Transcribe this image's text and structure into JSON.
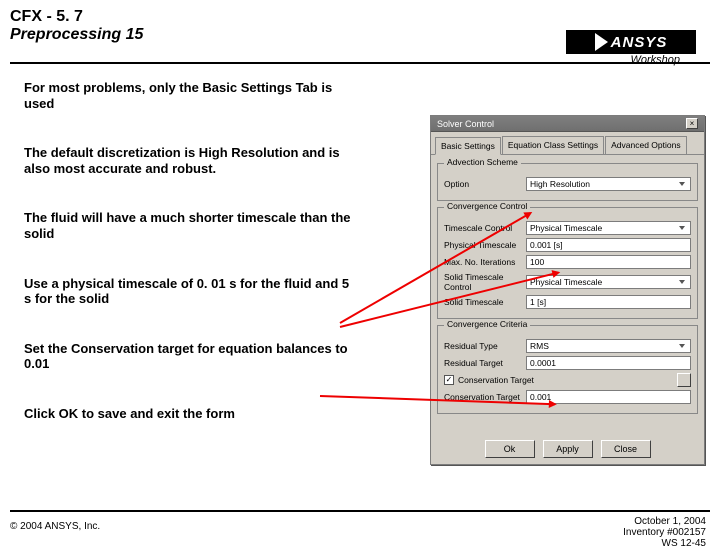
{
  "header": {
    "line1": "CFX - 5. 7",
    "line2": "Preprocessing 15",
    "logo_text": "ANSYS",
    "workshop": "Workshop"
  },
  "bullets": {
    "b1": "For most problems, only the Basic Settings Tab is used",
    "b2": "The default discretization is High Resolution and is also most accurate and robust.",
    "b3": "The fluid will have a much shorter timescale than the solid",
    "b4": "Use a physical timescale of 0. 01 s for the fluid and 5 s for the solid",
    "b5": "Set the Conservation target for equation balances to 0.01",
    "b6": "Click OK to save and exit the form"
  },
  "dialog": {
    "title": "Solver Control",
    "tabs": {
      "t1": "Basic Settings",
      "t2": "Equation Class Settings",
      "t3": "Advanced Options"
    },
    "adv_group": "Advection Scheme",
    "adv_option_lbl": "Option",
    "adv_option_val": "High Resolution",
    "conv_group": "Convergence Control",
    "tc_lbl": "Timescale Control",
    "tc_val": "Physical Timescale",
    "pt_lbl": "Physical Timescale",
    "pt_val": "0.001 [s]",
    "mi_lbl": "Max. No. Iterations",
    "mi_val": "100",
    "stc_lbl": "Solid Timescale Control",
    "stc_val": "Physical Timescale",
    "st_lbl": "Solid Timescale",
    "st_val": "1 [s]",
    "crit_group": "Convergence Criteria",
    "rt_lbl": "Residual Type",
    "rt_val": "RMS",
    "rtg_lbl": "Residual Target",
    "rtg_val": "0.0001",
    "ct_chk": "Conservation Target",
    "ct_lbl": "Conservation Target",
    "ct_val": "0.001",
    "btn_ok": "Ok",
    "btn_apply": "Apply",
    "btn_close": "Close"
  },
  "footer": {
    "copyright": "© 2004 ANSYS, Inc.",
    "date": "October 1, 2004",
    "inventory": "Inventory #002157",
    "slide": "WS 12-45"
  }
}
